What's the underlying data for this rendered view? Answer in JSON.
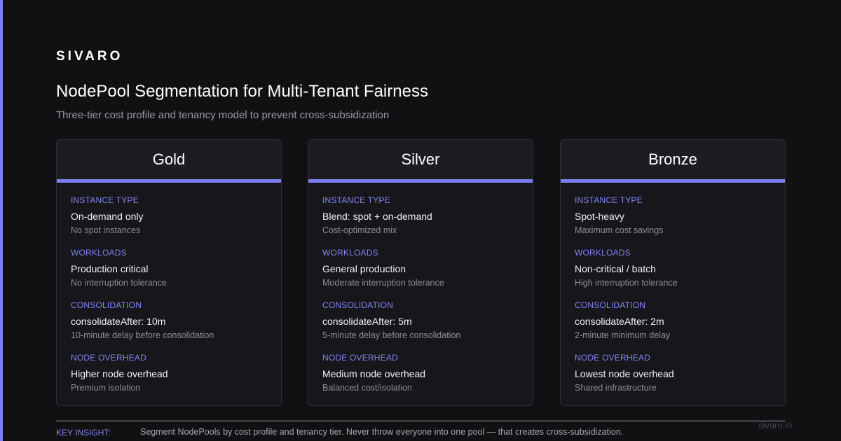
{
  "brand": "SIVARO",
  "title": "NodePool Segmentation for Multi-Tenant Fairness",
  "subtitle": "Three-tier cost profile and tenancy model to prevent cross-subsidization",
  "accent_color": "#7b7ff0",
  "tiers": [
    {
      "name": "Gold",
      "sections": [
        {
          "label": "INSTANCE TYPE",
          "value": "On-demand only",
          "note": "No spot instances"
        },
        {
          "label": "WORKLOADS",
          "value": "Production critical",
          "note": "No interruption tolerance"
        },
        {
          "label": "CONSOLIDATION",
          "value": "consolidateAfter: 10m",
          "note": "10-minute delay before consolidation"
        },
        {
          "label": "NODE OVERHEAD",
          "value": "Higher node overhead",
          "note": "Premium isolation"
        }
      ]
    },
    {
      "name": "Silver",
      "sections": [
        {
          "label": "INSTANCE TYPE",
          "value": "Blend: spot + on-demand",
          "note": "Cost-optimized mix"
        },
        {
          "label": "WORKLOADS",
          "value": "General production",
          "note": "Moderate interruption tolerance"
        },
        {
          "label": "CONSOLIDATION",
          "value": "consolidateAfter: 5m",
          "note": "5-minute delay before consolidation"
        },
        {
          "label": "NODE OVERHEAD",
          "value": "Medium node overhead",
          "note": "Balanced cost/isolation"
        }
      ]
    },
    {
      "name": "Bronze",
      "sections": [
        {
          "label": "INSTANCE TYPE",
          "value": "Spot-heavy",
          "note": "Maximum cost savings"
        },
        {
          "label": "WORKLOADS",
          "value": "Non-critical / batch",
          "note": "High interruption tolerance"
        },
        {
          "label": "CONSOLIDATION",
          "value": "consolidateAfter: 2m",
          "note": "2-minute minimum delay"
        },
        {
          "label": "NODE OVERHEAD",
          "value": "Lowest node overhead",
          "note": "Shared infrastructure"
        }
      ]
    }
  ],
  "footer": {
    "insight_label": "KEY INSIGHT:",
    "insight_text": "Segment NodePools by cost profile and tenancy tier. Never throw everyone into one pool — that creates cross-subsidization.",
    "watermark": "sivaro.in"
  }
}
